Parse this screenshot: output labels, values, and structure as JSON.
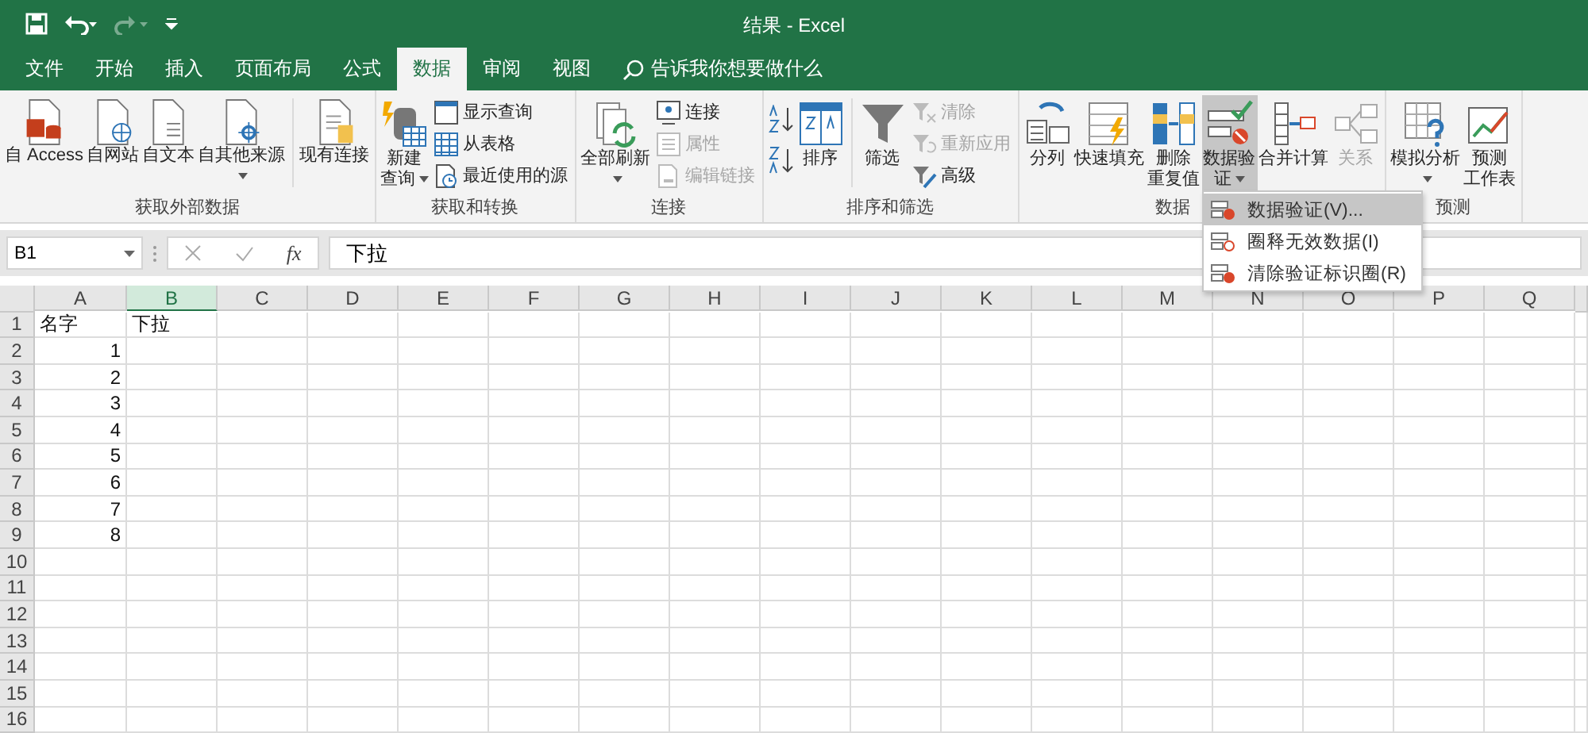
{
  "window": {
    "title": "结果 - Excel"
  },
  "quick_access": {
    "redo": {
      "disabled": true
    }
  },
  "tabs": [
    {
      "label": "文件",
      "selected": false
    },
    {
      "label": "开始",
      "selected": false
    },
    {
      "label": "插入",
      "selected": false
    },
    {
      "label": "页面布局",
      "selected": false
    },
    {
      "label": "公式",
      "selected": false
    },
    {
      "label": "数据",
      "selected": true
    },
    {
      "label": "审阅",
      "selected": false
    },
    {
      "label": "视图",
      "selected": false
    }
  ],
  "tell_me": {
    "placeholder": "告诉我你想要做什么"
  },
  "ribbon": {
    "groups": [
      {
        "label": "获取外部数据",
        "items": [
          {
            "kind": "large",
            "lines": [
              "自 Access"
            ],
            "caret": false,
            "disabled": false,
            "pressed": false
          },
          {
            "kind": "large",
            "lines": [
              "自网站"
            ],
            "caret": false,
            "disabled": false,
            "pressed": false
          },
          {
            "kind": "large",
            "lines": [
              "自文本"
            ],
            "caret": false,
            "disabled": false,
            "pressed": false
          },
          {
            "kind": "large",
            "lines": [
              "自其他来源"
            ],
            "caret": true,
            "disabled": false,
            "pressed": false
          },
          {
            "kind": "separator"
          },
          {
            "kind": "large",
            "lines": [
              "现有连接"
            ],
            "caret": false,
            "disabled": false,
            "pressed": false
          }
        ]
      },
      {
        "label": "获取和转换",
        "items": [
          {
            "kind": "large",
            "lines": [
              "新建",
              "查询"
            ],
            "caret": true,
            "disabled": false,
            "pressed": false
          },
          {
            "kind": "stack",
            "items": [
              {
                "label": "显示查询",
                "disabled": false
              },
              {
                "label": "从表格",
                "disabled": false
              },
              {
                "label": "最近使用的源",
                "disabled": false
              }
            ]
          }
        ]
      },
      {
        "label": "连接",
        "items": [
          {
            "kind": "large",
            "lines": [
              "全部刷新"
            ],
            "caret": true,
            "disabled": false,
            "pressed": false
          },
          {
            "kind": "stack",
            "items": [
              {
                "label": "连接",
                "disabled": false
              },
              {
                "label": "属性",
                "disabled": true
              },
              {
                "label": "编辑链接",
                "disabled": true
              }
            ]
          }
        ]
      },
      {
        "label": "排序和筛选",
        "items": [
          {
            "kind": "sort-pair"
          },
          {
            "kind": "large",
            "lines": [
              "排序"
            ],
            "caret": false,
            "disabled": false,
            "pressed": false
          },
          {
            "kind": "separator"
          },
          {
            "kind": "large",
            "lines": [
              "筛选"
            ],
            "caret": false,
            "disabled": false,
            "pressed": false
          },
          {
            "kind": "stack",
            "items": [
              {
                "label": "清除",
                "disabled": true
              },
              {
                "label": "重新应用",
                "disabled": true
              },
              {
                "label": "高级",
                "disabled": false
              }
            ]
          }
        ]
      },
      {
        "label": "数据",
        "items": [
          {
            "kind": "large",
            "lines": [
              "分列"
            ],
            "caret": false,
            "disabled": false,
            "pressed": false
          },
          {
            "kind": "large",
            "lines": [
              "快速填充"
            ],
            "caret": false,
            "disabled": false,
            "pressed": false
          },
          {
            "kind": "large",
            "lines": [
              "删除",
              "重复值"
            ],
            "caret": false,
            "disabled": false,
            "pressed": false
          },
          {
            "kind": "large",
            "lines": [
              "数据验",
              "证"
            ],
            "caret": true,
            "disabled": false,
            "pressed": true
          },
          {
            "kind": "large",
            "lines": [
              "合并计算"
            ],
            "caret": false,
            "disabled": false,
            "pressed": false
          },
          {
            "kind": "large",
            "lines": [
              "关系"
            ],
            "caret": false,
            "disabled": true,
            "pressed": false
          }
        ]
      },
      {
        "label": "预测",
        "items": [
          {
            "kind": "large",
            "lines": [
              "模拟分析"
            ],
            "caret": true,
            "disabled": false,
            "pressed": false
          },
          {
            "kind": "large",
            "lines": [
              "预测",
              "工作表"
            ],
            "caret": false,
            "disabled": false,
            "pressed": false
          }
        ]
      }
    ]
  },
  "menu": {
    "items": [
      {
        "label": "数据验证(V)...",
        "selected": true
      },
      {
        "label": "圈释无效数据(I)",
        "selected": false
      },
      {
        "label": "清除验证标识圈(R)",
        "selected": false
      }
    ]
  },
  "formula_bar": {
    "name_box": "B1",
    "function_label": "fx",
    "value": "下拉"
  },
  "sheet": {
    "columns": [
      {
        "label": "A",
        "selected": false
      },
      {
        "label": "B",
        "selected": true
      },
      {
        "label": "C",
        "selected": false
      },
      {
        "label": "D",
        "selected": false
      },
      {
        "label": "E",
        "selected": false
      },
      {
        "label": "F",
        "selected": false
      },
      {
        "label": "G",
        "selected": false
      },
      {
        "label": "H",
        "selected": false
      },
      {
        "label": "I",
        "selected": false
      },
      {
        "label": "J",
        "selected": false
      },
      {
        "label": "K",
        "selected": false
      },
      {
        "label": "L",
        "selected": false
      },
      {
        "label": "M",
        "selected": false
      },
      {
        "label": "N",
        "selected": false
      },
      {
        "label": "O",
        "selected": false
      },
      {
        "label": "P",
        "selected": false
      },
      {
        "label": "Q",
        "selected": false
      }
    ],
    "rows": [
      {
        "number": "1",
        "cells": [
          {
            "text": "名字",
            "kind": "text"
          },
          {
            "text": "下拉",
            "kind": "text"
          }
        ]
      },
      {
        "number": "2",
        "cells": [
          {
            "text": "1",
            "kind": "number"
          }
        ]
      },
      {
        "number": "3",
        "cells": [
          {
            "text": "2",
            "kind": "number"
          }
        ]
      },
      {
        "number": "4",
        "cells": [
          {
            "text": "3",
            "kind": "number"
          }
        ]
      },
      {
        "number": "5",
        "cells": [
          {
            "text": "4",
            "kind": "number"
          }
        ]
      },
      {
        "number": "6",
        "cells": [
          {
            "text": "5",
            "kind": "number"
          }
        ]
      },
      {
        "number": "7",
        "cells": [
          {
            "text": "6",
            "kind": "number"
          }
        ]
      },
      {
        "number": "8",
        "cells": [
          {
            "text": "7",
            "kind": "number"
          }
        ]
      },
      {
        "number": "9",
        "cells": [
          {
            "text": "8",
            "kind": "number"
          }
        ]
      },
      {
        "number": "10",
        "cells": []
      },
      {
        "number": "11",
        "cells": []
      },
      {
        "number": "12",
        "cells": []
      },
      {
        "number": "13",
        "cells": []
      },
      {
        "number": "14",
        "cells": []
      },
      {
        "number": "15",
        "cells": []
      },
      {
        "number": "16",
        "cells": []
      }
    ]
  }
}
